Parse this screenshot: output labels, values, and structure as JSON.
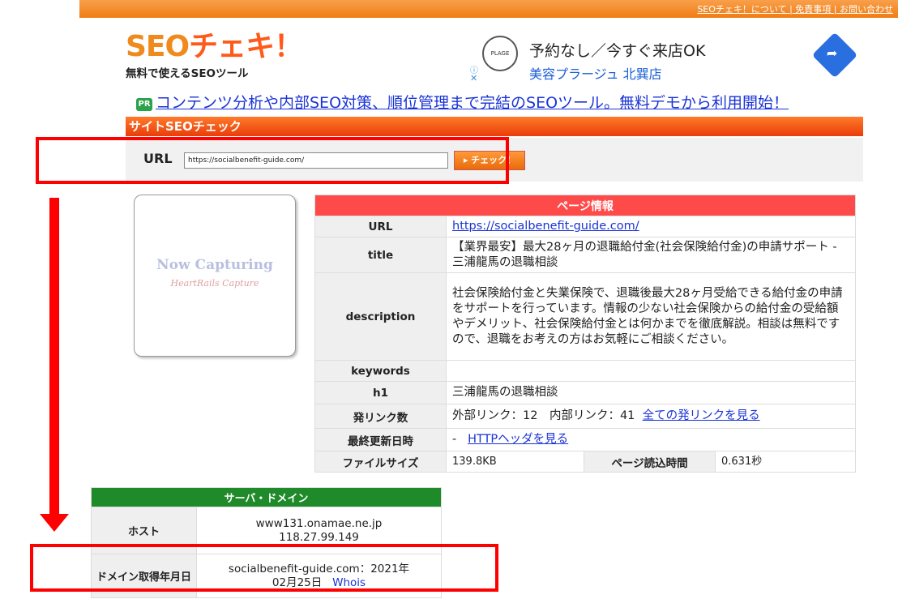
{
  "topbar": {
    "links": "SEOチェキ！について | 免責事項 | お問い合わせ"
  },
  "logo": {
    "seo": "SEO",
    "jp": "チェキ！",
    "tagline": "無料で使えるSEOツール"
  },
  "ad": {
    "line1": "予約なし／今すぐ来店OK",
    "line2": "美容プラージュ 北巽店",
    "logo_text": "PLAGE",
    "info_icon": "info-icon",
    "close_icon": "close-icon",
    "direction_icon": "directions-icon"
  },
  "pr": {
    "badge": "PR",
    "link": "コンテンツ分析や内部SEO対策、順位管理まで完結のSEOツール。無料デモから利用開始！"
  },
  "section_title": "サイトSEOチェック",
  "url_form": {
    "label": "URL",
    "value": "https://socialbenefit-guide.com/",
    "button": "▸ チェック！"
  },
  "capture": {
    "line1": "Now Capturing",
    "line2": "HeartRails Capture"
  },
  "page_info": {
    "header": "ページ情報",
    "url_label": "URL",
    "url_value": "https://socialbenefit-guide.com/",
    "title_label": "title",
    "title_value": "【業界最安】最大28ヶ月の退職給付金(社会保険給付金)の申請サポート - 三浦龍馬の退職相談",
    "description_label": "description",
    "description_value": "社会保険給付金と失業保険で、退職後最大28ヶ月受給できる給付金の申請をサポートを行っています。情報の少ない社会保険からの給付金の受給額やデメリット、社会保険給付金とは何かまでを徹底解説。相談は無料ですので、退職をお考えの方はお気軽にご相談ください。",
    "keywords_label": "keywords",
    "keywords_value": "",
    "h1_label": "h1",
    "h1_value": "三浦龍馬の退職相談",
    "links_label": "発リンク数",
    "links_value": "外部リンク：12　内部リンク：41",
    "links_more": "全ての発リンクを見る",
    "updated_label": "最終更新日時",
    "updated_value": "-",
    "updated_link": "HTTPヘッダを見る",
    "filesize_label": "ファイルサイズ",
    "filesize_value": "139.8KB",
    "loadtime_label": "ページ読込時間",
    "loadtime_value": "0.631秒"
  },
  "server": {
    "header": "サーバ・ドメイン",
    "host_label": "ホスト",
    "host_line1": "www131.onamae.ne.jp",
    "host_line2": "118.27.99.149",
    "domain_label": "ドメイン取得年月日",
    "domain_line1": "socialbenefit-guide.com：2021年",
    "domain_line2": "02月25日",
    "whois": "Whois"
  },
  "annotations": {
    "color": "#ff0000"
  }
}
